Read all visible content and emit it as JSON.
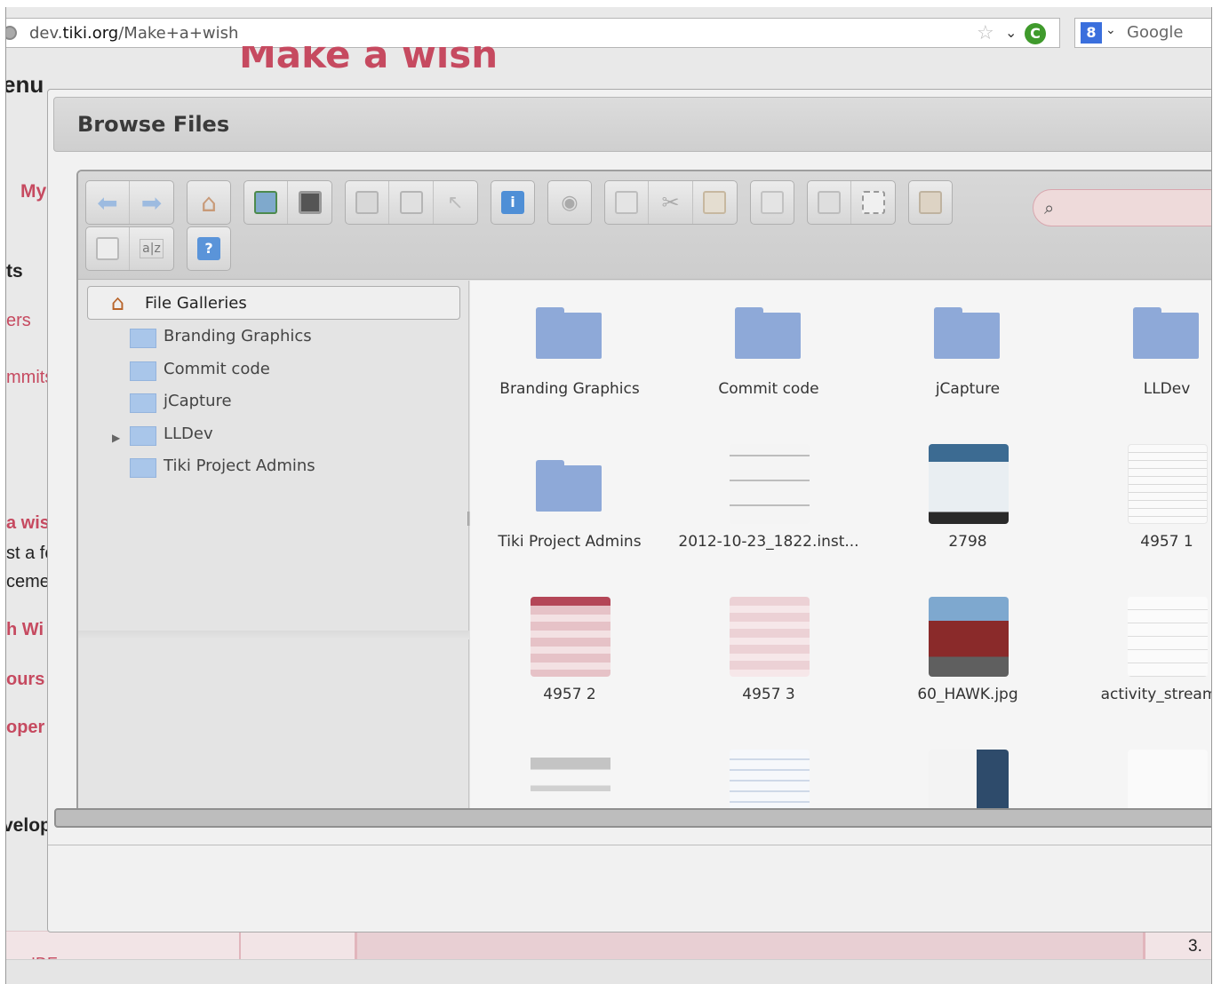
{
  "browser": {
    "url_prefix": "dev.",
    "url_domain": "tiki.org",
    "url_path": "/Make+a+wish",
    "search_engine": "Google"
  },
  "page": {
    "heading": "Make a wish",
    "sidebar": [
      "enu",
      "My",
      "ts",
      "ers",
      "mmits",
      "a wis",
      "st a fe",
      "ceme",
      "h Wi",
      "ours",
      "oper",
      "velop"
    ],
    "bottom_right": "3.",
    "bottom_left": "IDE"
  },
  "dialog": {
    "title": "Browse Files"
  },
  "tree": {
    "root": "File Galleries",
    "items": [
      "Branding Graphics",
      "Commit code",
      "jCapture",
      "LLDev",
      "Tiki Project Admins"
    ]
  },
  "files": [
    {
      "name": "Branding Graphics",
      "kind": "folder"
    },
    {
      "name": "Commit code",
      "kind": "folder"
    },
    {
      "name": "jCapture",
      "kind": "folder"
    },
    {
      "name": "LLDev",
      "kind": "folder"
    },
    {
      "name": "Tiki Project Admins",
      "kind": "folder"
    },
    {
      "name": "2012-10-23_1822.inst...",
      "kind": "image"
    },
    {
      "name": "2798",
      "kind": "image"
    },
    {
      "name": "4957 1",
      "kind": "image"
    },
    {
      "name": "4957 2",
      "kind": "image"
    },
    {
      "name": "4957 3",
      "kind": "image"
    },
    {
      "name": "60_HAWK.jpg",
      "kind": "image"
    },
    {
      "name": "activity_stream_L",
      "kind": "image"
    },
    {
      "name": "",
      "kind": "image"
    },
    {
      "name": "",
      "kind": "image"
    },
    {
      "name": "",
      "kind": "image"
    },
    {
      "name": "",
      "kind": "image"
    }
  ],
  "colors": {
    "accent": "#c64a60",
    "folder": "#8ea9d8"
  }
}
